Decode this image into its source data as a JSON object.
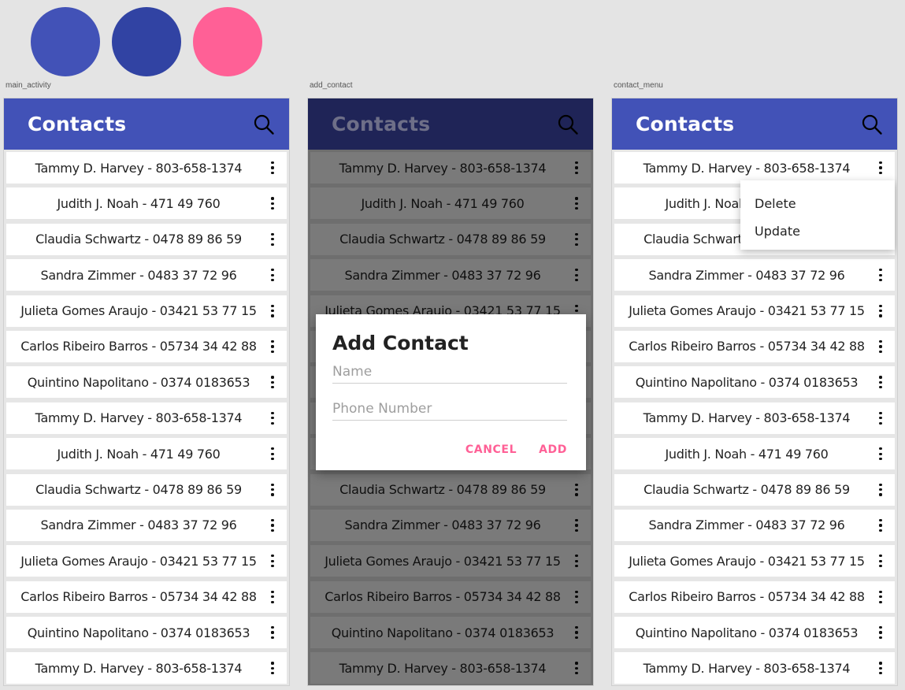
{
  "colors": {
    "primary": "#4252b7",
    "primary_dark": "#3143a3",
    "accent": "#ff6096",
    "dimmed_appbar": "#1f2457",
    "dimmed_title": "#6e6f88"
  },
  "swatches": [
    "#4252b7",
    "#3143a3",
    "#ff6096"
  ],
  "frames": {
    "main": {
      "label": "main_activity",
      "title": "Contacts"
    },
    "add": {
      "label": "add_contact",
      "title": "Contacts"
    },
    "menu": {
      "label": "contact_menu",
      "title": "Contacts"
    }
  },
  "contacts": [
    "Tammy D. Harvey - 803-658-1374",
    "Judith J. Noah - 471 49 760",
    "Claudia Schwartz - 0478 89 86 59",
    "Sandra Zimmer - 0483 37 72 96",
    "Julieta Gomes Araujo - 03421 53 77 15",
    "Carlos Ribeiro Barros - 05734 34 42 88",
    "Quintino Napolitano - 0374 0183653",
    "Tammy D. Harvey - 803-658-1374",
    "Judith J. Noah - 471 49 760",
    "Claudia Schwartz - 0478 89 86 59",
    "Sandra Zimmer - 0483 37 72 96",
    "Julieta Gomes Araujo - 03421 53 77 15",
    "Carlos Ribeiro Barros - 05734 34 42 88",
    "Quintino Napolitano - 0374 0183653",
    "Tammy D. Harvey - 803-658-1374"
  ],
  "dialog": {
    "title": "Add Contact",
    "name_placeholder": "Name",
    "name_value": "",
    "phone_placeholder": "Phone Number",
    "phone_value": "",
    "cancel_label": "CANCEL",
    "add_label": "ADD"
  },
  "menu": {
    "items": [
      "Delete",
      "Update"
    ]
  },
  "icons": {
    "search": "search-icon",
    "more": "more-vert-icon"
  }
}
